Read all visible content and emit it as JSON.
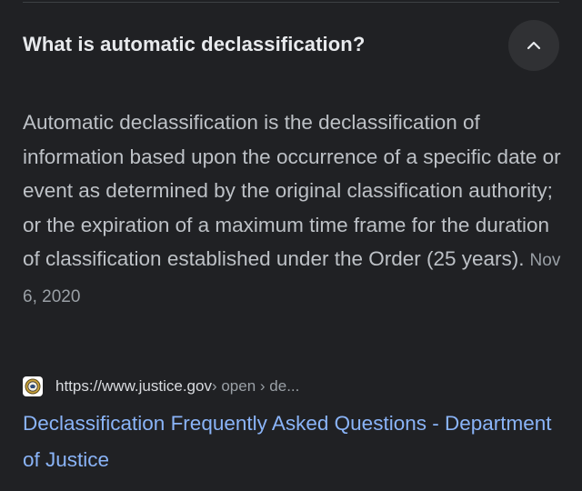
{
  "question": {
    "text": "What is automatic declassification?",
    "toggle_icon": "chevron-up-icon"
  },
  "answer": {
    "text": "Automatic declassification is the declassification of information based upon the occurrence of a specific date or event as determined by the original classification authority; or the expiration of a maximum time frame for the duration of classification established under the Order (25 years).",
    "date": "Nov 6, 2020"
  },
  "source": {
    "favicon": "doj-seal-icon",
    "url": "https://www.justice.gov",
    "path": " › open › de..."
  },
  "result": {
    "title": "Declassification Frequently Asked Questions - Department of Justice"
  },
  "colors": {
    "background": "#202124",
    "heading": "#e8eaed",
    "body_text": "#bdc1c6",
    "link": "#8ab4f8",
    "muted": "#9aa0a6"
  }
}
